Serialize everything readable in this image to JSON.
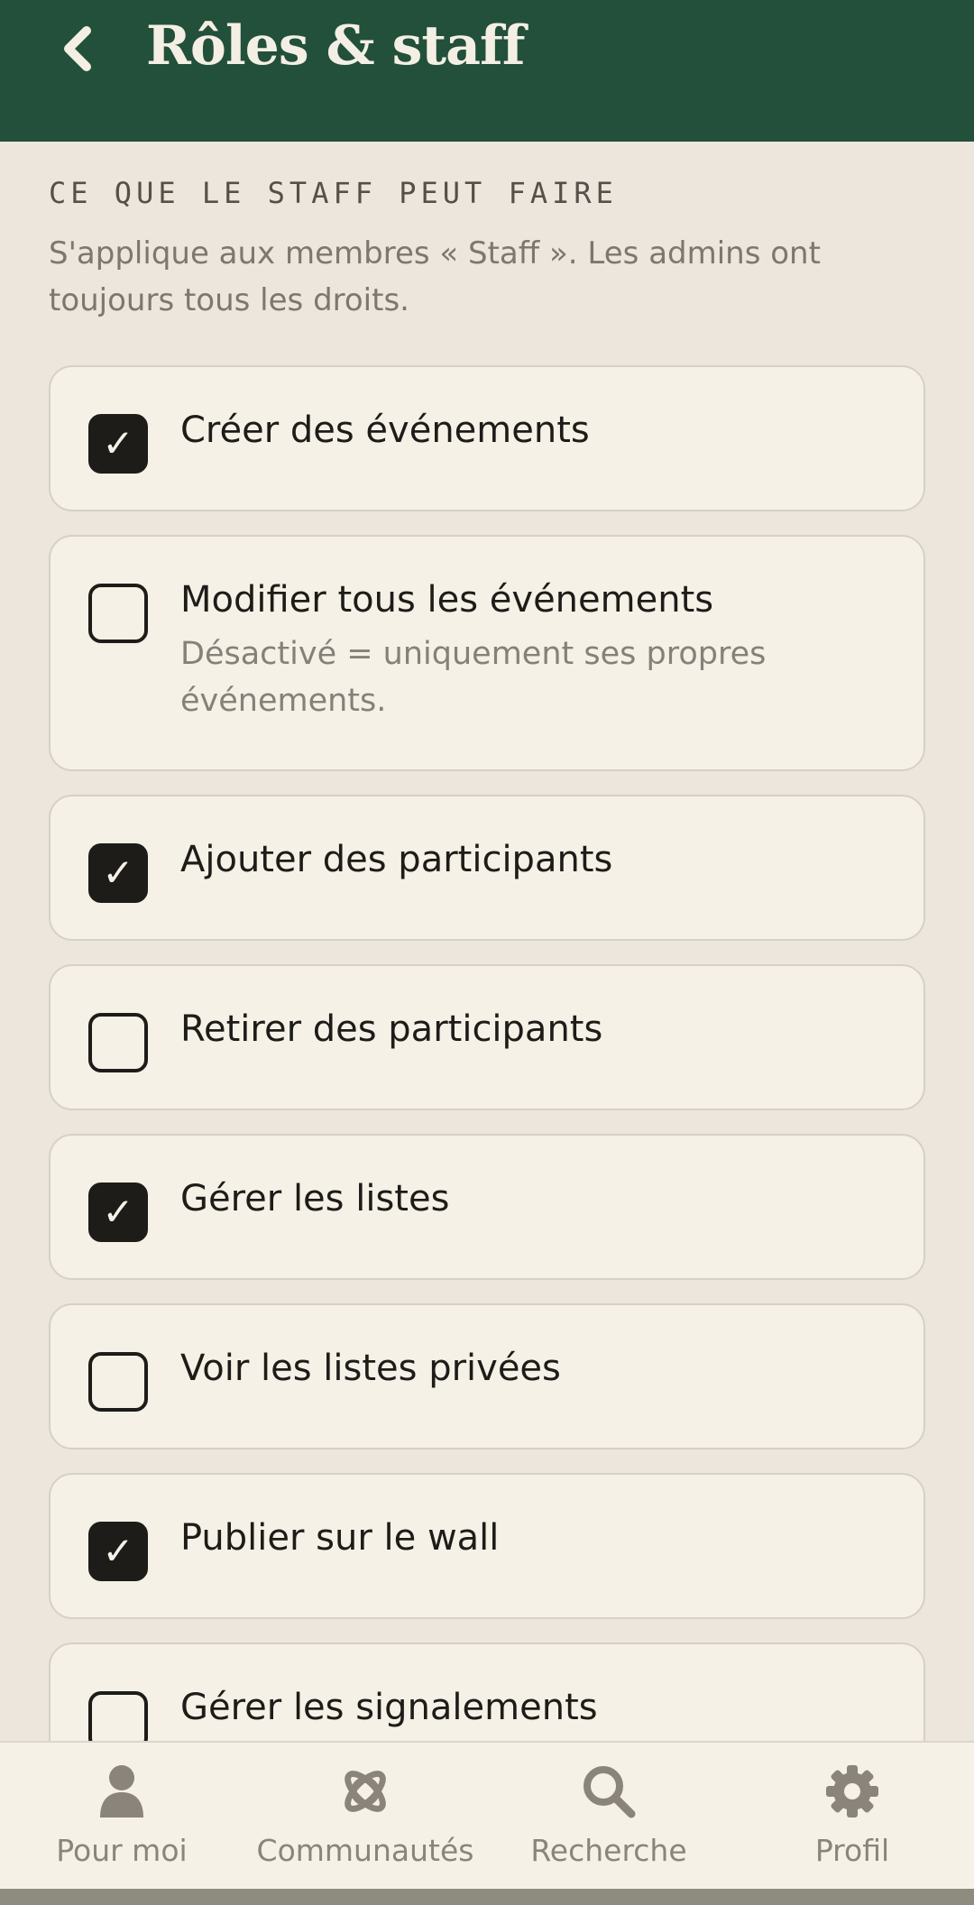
{
  "header": {
    "title": "Rôles & staff",
    "back_icon": "chevron-left-icon",
    "background": "#22503a"
  },
  "section": {
    "heading": "CE QUE LE STAFF PEUT FAIRE",
    "description": "S'applique aux membres « Staff ». Les admins ont toujours tous les droits."
  },
  "permissions": [
    {
      "label": "Créer des événements",
      "checked": true,
      "sub": ""
    },
    {
      "label": "Modifier tous les événements",
      "checked": false,
      "sub": "Désactivé = uniquement ses propres événements."
    },
    {
      "label": "Ajouter des participants",
      "checked": true,
      "sub": ""
    },
    {
      "label": "Retirer des participants",
      "checked": false,
      "sub": ""
    },
    {
      "label": "Gérer les listes",
      "checked": true,
      "sub": ""
    },
    {
      "label": "Voir les listes privées",
      "checked": false,
      "sub": ""
    },
    {
      "label": "Publier sur le wall",
      "checked": true,
      "sub": ""
    },
    {
      "label": "Gérer les signalements",
      "checked": false,
      "sub": ""
    }
  ],
  "checkmark": "✓",
  "nav": [
    {
      "label": "Pour moi",
      "icon": "person-icon"
    },
    {
      "label": "Communautés",
      "icon": "communities-icon"
    },
    {
      "label": "Recherche",
      "icon": "search-icon"
    },
    {
      "label": "Profil",
      "icon": "gear-icon"
    }
  ]
}
